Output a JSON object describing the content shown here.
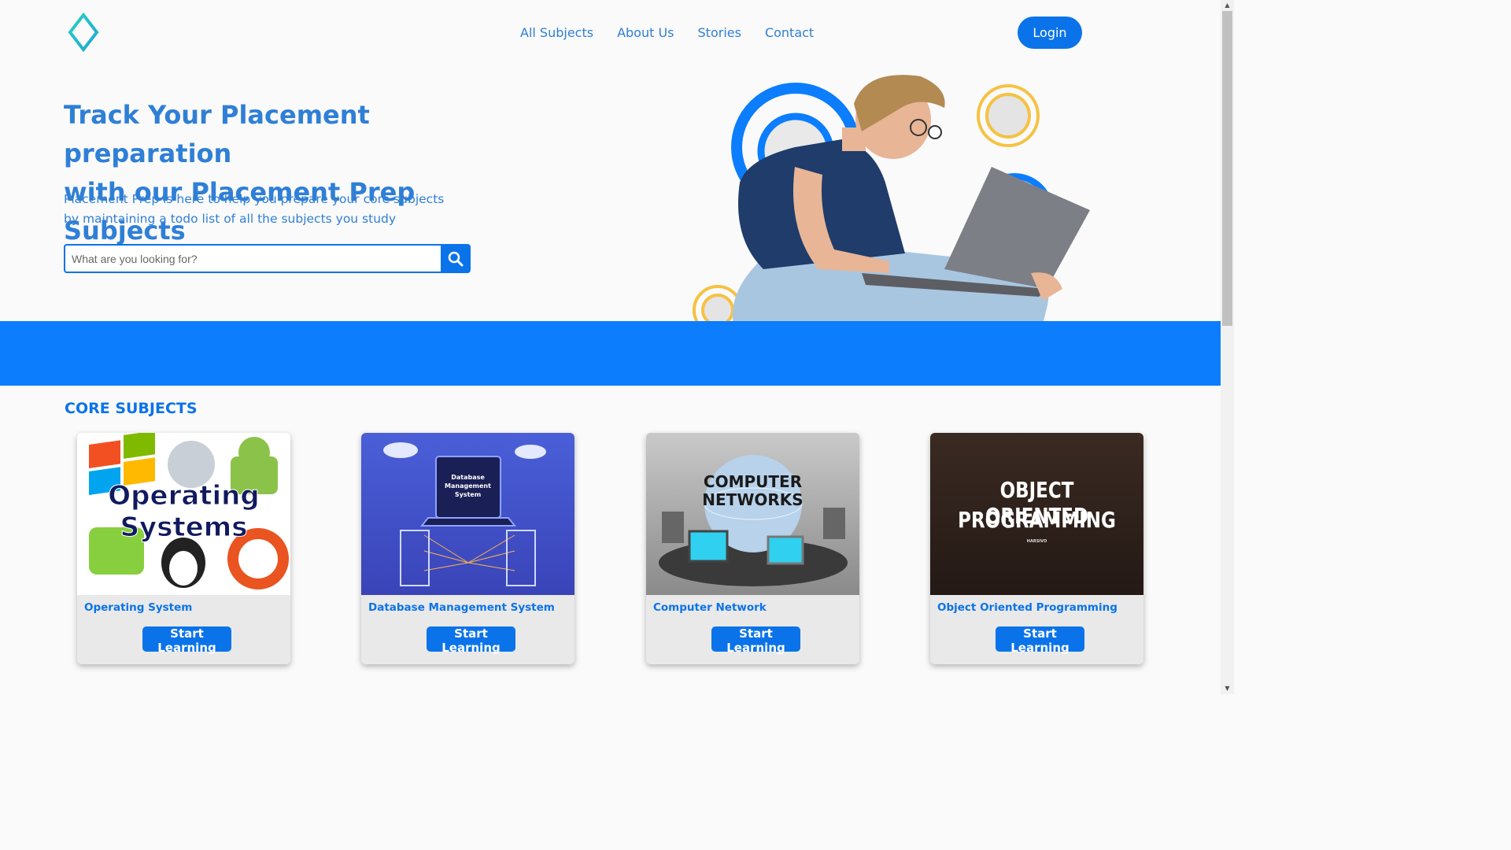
{
  "nav": {
    "links": [
      "All Subjects",
      "About Us",
      "Stories",
      "Contact"
    ],
    "login_label": "Login"
  },
  "hero": {
    "title_line1": "Track Your Placement preparation",
    "title_line2": "with our Placement Prep Subjects",
    "sub_line1": "Placement Prep is here to help you prepare your core subjects",
    "sub_line2": "by maintaining a todo list of all the subjects you study",
    "search_placeholder": "What are you looking for?"
  },
  "section": {
    "title": "CORE SUBJECTS"
  },
  "subjects": [
    {
      "name": "Operating System",
      "button": "Start Learning",
      "thumb_line1": "Operating",
      "thumb_line2": "Systems"
    },
    {
      "name": "Database Management System",
      "button": "Start Learning",
      "thumb_line1": "Database",
      "thumb_line2": "Management",
      "thumb_line3": "System"
    },
    {
      "name": "Computer Network",
      "button": "Start Learning",
      "thumb_line1": "COMPUTER",
      "thumb_line2": "NETWORKS"
    },
    {
      "name": "Object Oriented Programming",
      "button": "Start Learning",
      "thumb_line1": "OBJECT ORIENTED",
      "thumb_line2": "PROGRAMMING",
      "thumb_line3": "HARSIVO"
    }
  ],
  "colors": {
    "accent": "#0b73ea",
    "band": "#0b7dfd",
    "text_blue": "#2f7fd6",
    "ring_yellow": "#f5c242"
  }
}
